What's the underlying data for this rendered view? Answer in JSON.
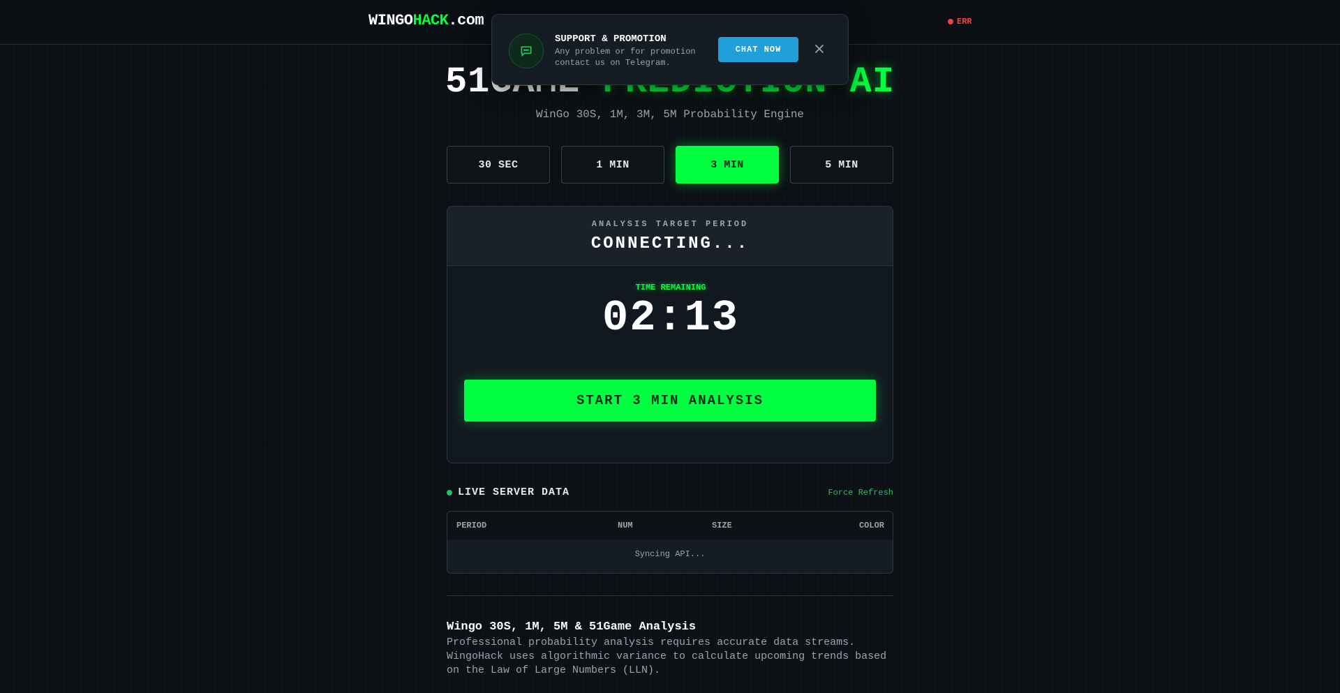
{
  "header": {
    "logo_prefix": "WINGO",
    "logo_accent": "HACK",
    "logo_suffix": ".com",
    "status_text": "ERR"
  },
  "toast": {
    "icon": "chat-bubble-icon",
    "title": "SUPPORT & PROMOTION",
    "text": "Any problem or for promotion contact us on Telegram.",
    "button_label": "CHAT NOW",
    "close_icon": "close-icon"
  },
  "hero": {
    "title_main": "51GAME",
    "title_accent": "PREDICTION AI",
    "subtitle": "WinGo 30S, 1M, 3M, 5M Probability Engine"
  },
  "tabs": [
    {
      "label": "30 SEC",
      "active": false
    },
    {
      "label": "1 MIN",
      "active": false
    },
    {
      "label": "3 MIN",
      "active": true
    },
    {
      "label": "5 MIN",
      "active": false
    }
  ],
  "analysis": {
    "target_label": "ANALYSIS TARGET PERIOD",
    "target_value": "CONNECTING...",
    "time_label": "TIME REMAINING",
    "timer": "02:13",
    "start_button": "START 3 MIN ANALYSIS"
  },
  "live": {
    "title": "LIVE SERVER DATA",
    "refresh_label": "Force Refresh",
    "columns": [
      "PERIOD",
      "NUM",
      "SIZE",
      "COLOR"
    ],
    "empty_text": "Syncing API..."
  },
  "article": {
    "title": "Wingo 30S, 1M, 5M & 51Game Analysis",
    "text": "Professional probability analysis requires accurate data streams. WingoHack uses algorithmic variance to calculate upcoming trends based on the Law of Large Numbers (LLN)."
  },
  "colors": {
    "accent": "#00ff41",
    "background": "#0b0f14",
    "telegram": "#229ed9",
    "error": "#ef4444"
  }
}
